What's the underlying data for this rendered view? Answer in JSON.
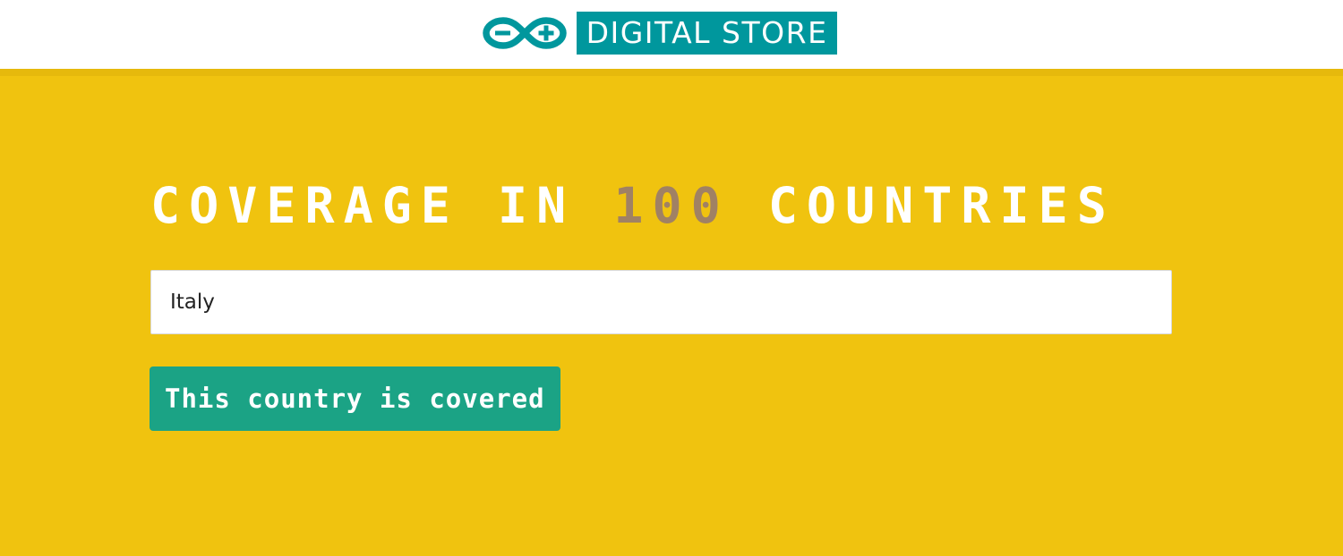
{
  "header": {
    "brand_name": "DIGITAL STORE",
    "logo_icon": "arduino-infinity-logo-icon",
    "brand_color": "#00979d"
  },
  "hero": {
    "title_before": "COVERAGE IN ",
    "title_number": "100",
    "title_after": " COUNTRIES",
    "background_color": "#f0c30f",
    "number_color": "#a08164"
  },
  "search": {
    "value": "Italy",
    "placeholder": ""
  },
  "result": {
    "status_text": "This country is covered",
    "status_color": "#1ba385"
  }
}
